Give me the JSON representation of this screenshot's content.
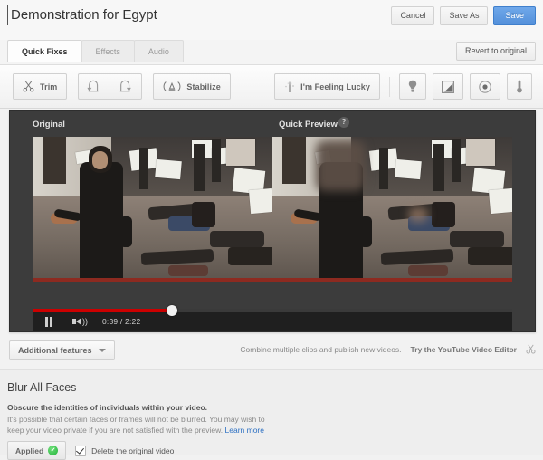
{
  "header": {
    "title": "Demonstration for Egypt",
    "buttons": [
      {
        "label": "Cancel",
        "name": "cancel-button",
        "primary": false
      },
      {
        "label": "Save As",
        "name": "save-as-button",
        "primary": false
      },
      {
        "label": "Save",
        "name": "save-button",
        "primary": true
      }
    ]
  },
  "tabs": {
    "items": [
      {
        "label": "Quick Fixes",
        "active": true
      },
      {
        "label": "Effects",
        "active": false
      },
      {
        "label": "Audio",
        "active": false
      }
    ],
    "revert_label": "Revert to original"
  },
  "toolbar": {
    "trim_label": "Trim",
    "rotate_left_icon": "rotate-left-icon",
    "rotate_right_icon": "rotate-right-icon",
    "stabilize_label": "Stabilize",
    "lucky_label": "I'm Feeling Lucky",
    "fill_light_icon": "lightbulb-icon",
    "contrast_icon": "contrast-icon",
    "saturation_icon": "saturation-icon",
    "temperature_icon": "thermometer-icon"
  },
  "preview": {
    "original_label": "Original",
    "quick_preview_label": "Quick Preview",
    "help_glyph": "?"
  },
  "player": {
    "current_time": "0:39",
    "separator": "/",
    "total_time": "2:22",
    "time_display": "0:39 / 2:22",
    "progress_percent": 29,
    "state": "playing",
    "progress_color": "#cc0000"
  },
  "features": {
    "additional_features_label": "Additional features",
    "combine_text": "Combine multiple clips and publish new videos.",
    "editor_link": "Try the YouTube Video Editor"
  },
  "blur_section": {
    "title": "Blur All Faces",
    "subtitle": "Obscure the identities of individuals within your video.",
    "description": "It's possible that certain faces or frames will not be blurred. You may wish to keep your video private if you are not satisfied with the preview.",
    "learn_more": "Learn more",
    "applied_label": "Applied",
    "applied_glyph": "✓",
    "delete_original_label": "Delete the original video",
    "delete_original_checked": true,
    "accent_green": "#23b23a"
  }
}
